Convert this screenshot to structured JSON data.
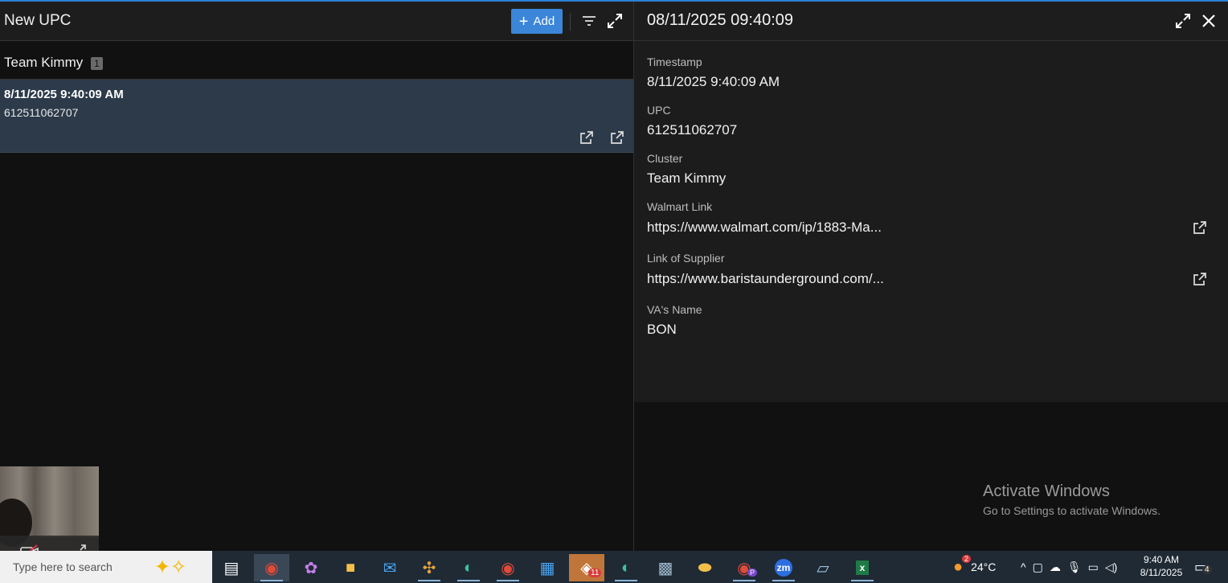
{
  "left_pane": {
    "title": "New UPC",
    "add_label": "Add",
    "group": {
      "name": "Team Kimmy",
      "count": "1"
    },
    "rows": [
      {
        "timestamp": "8/11/2025 9:40:09 AM",
        "upc": "612511062707"
      }
    ]
  },
  "right_pane": {
    "title": "08/11/2025 09:40:09",
    "fields": [
      {
        "label": "Timestamp",
        "value": "8/11/2025 9:40:09 AM"
      },
      {
        "label": "UPC",
        "value": "612511062707"
      },
      {
        "label": "Cluster",
        "value": "Team Kimmy"
      },
      {
        "label": "Walmart Link",
        "value": "https://www.walmart.com/ip/1883-Ma..."
      },
      {
        "label": "Link of Supplier",
        "value": "https://www.baristaunderground.com/..."
      },
      {
        "label": "VA's Name",
        "value": "BON"
      }
    ]
  },
  "watermark": {
    "line1": "Activate Windows",
    "line2": "Go to Settings to activate Windows."
  },
  "taskbar": {
    "search_placeholder": "Type here to search",
    "outlook_badge": "11",
    "chrome_badge": "P",
    "weather_badge": "2",
    "weather": "24°C",
    "time": "9:40 AM",
    "date": "8/11/2025",
    "notifications": "4"
  },
  "colors": {
    "accent": "#3b86d8",
    "selected_row": "#2c3a4a",
    "panel": "#1c1c1c",
    "background": "#111111"
  }
}
